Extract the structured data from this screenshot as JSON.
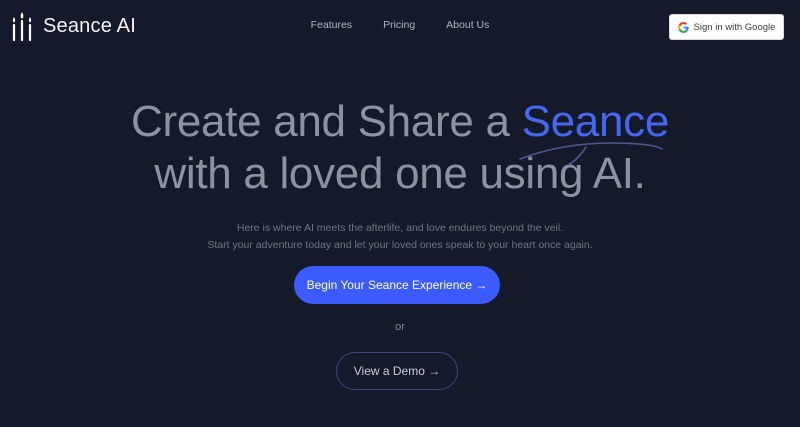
{
  "brand": {
    "name": "Seance AI",
    "logo_icon": "candles-icon"
  },
  "nav": {
    "items": [
      {
        "label": "Features"
      },
      {
        "label": "Pricing"
      },
      {
        "label": "About Us"
      }
    ]
  },
  "auth": {
    "signin_label": "Sign in with Google",
    "icon": "google-icon"
  },
  "hero": {
    "headline_part1": "Create and Share a ",
    "headline_highlight": "Seance",
    "headline_line2": "with a loved one using AI.",
    "subtitle_line1": "Here is where AI meets the afterlife, and love endures beyond the veil.",
    "subtitle_line2": "Start your adventure today and let your loved ones speak to your heart once again.",
    "cta_label": "Begin Your Seance Experience →",
    "or_text": "or",
    "demo_label": "View a Demo →"
  },
  "colors": {
    "background": "#151a2b",
    "accent": "#3b5bfa",
    "highlight_text": "#4666f0",
    "headline_text": "#8d92a0"
  }
}
